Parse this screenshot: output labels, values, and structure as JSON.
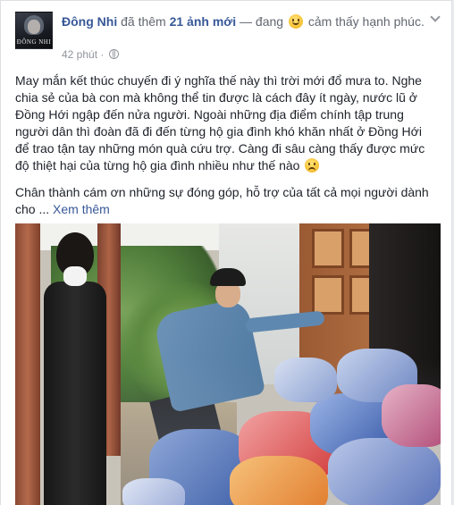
{
  "post": {
    "author": "Đông Nhi",
    "action_prefix": "đã thêm",
    "photo_count": "21 ảnh mới",
    "activity_prefix": "— đang",
    "feeling": "cảm thấy hạnh phúc.",
    "timestamp": "42 phút",
    "avatar_text": "ĐÔNG NHI",
    "paragraph_1": "May mắn kết thúc chuyến đi ý nghĩa thế này thì trời mới đổ mưa to. Nghe chia sẻ của bà con mà không thể tin được là cách đây ít ngày, nước lũ ở Đồng Hới ngập đến nửa người. Ngoài những địa điểm chính tập trung người dân thì đoàn đã đi đến từng hộ gia đình khó khăn nhất ở Đồng Hới để trao tận tay những món quà cứu trợ. Càng đi sâu càng thấy được mức độ thiệt hại của từng hộ gia đình nhiều như thế nào",
    "paragraph_2": "Chân thành cám ơn những sự đóng góp, hỗ trợ của tất cả mọi người dành cho ...",
    "see_more": "Xem thêm"
  },
  "icons": {
    "feeling": "smile-emoji-icon",
    "sad": "sad-emoji-icon",
    "privacy": "globe-icon",
    "menu": "chevron-down-icon"
  },
  "colors": {
    "link": "#385898",
    "text": "#1d2129",
    "meta": "#90949c"
  }
}
